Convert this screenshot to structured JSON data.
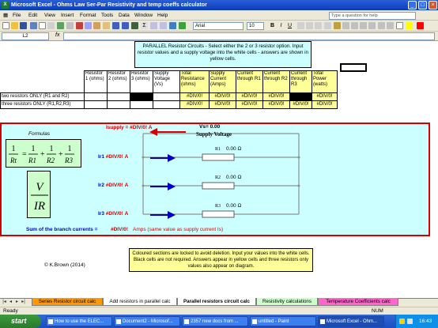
{
  "window": {
    "title": "Microsoft Excel - Ohms Law Ser-Par Resistivity and temp coeffs calculator",
    "app_icon_label": "X"
  },
  "menu": {
    "items": [
      "File",
      "Edit",
      "View",
      "Insert",
      "Format",
      "Tools",
      "Data",
      "Window",
      "Help"
    ],
    "help_placeholder": "Type a question for help"
  },
  "toolbar": {
    "font_name": "Arial",
    "font_size": "10",
    "bold": "B",
    "italic": "I",
    "underline": "U"
  },
  "formula_bar": {
    "name_box": "L2",
    "fx": "fx",
    "formula": ""
  },
  "sheet": {
    "top_note": "PARALLEL Resistor Circuits - Select either the 2 or 3 resistor option. Input resistor values and a supply voltage into the white cells - answers are shown in yellow cells.",
    "headers": [
      "Resistor 1 (ohms)",
      "Resistor 2 (ohms)",
      "Resistor 3 (ohms)",
      "Supply Voltage (Vs)",
      "Total Resistance (ohms)",
      "Supply Current (Amps)",
      "Current through R1",
      "Current through R2",
      "Current through R3",
      "Total Power (watts)"
    ],
    "rows": [
      {
        "label": "two resistors ONLY (R1 and R2)",
        "results": [
          "#DIV/0!",
          "#DIV/0!",
          "#DIV/0!",
          "#DIV/0!",
          "",
          "#DIV/0!"
        ]
      },
      {
        "label": "three resistors ONLY (R1,R2,R3)",
        "results": [
          "#DIV/0!",
          "#DIV/0!",
          "#DIV/0!",
          "#DIV/0!",
          "#DIV/0!",
          "#DIV/0!"
        ]
      }
    ]
  },
  "diagram": {
    "formulas_label": "Formulas",
    "formula1": {
      "lhs_num": "1",
      "lhs_den": "Rt",
      "terms": [
        {
          "num": "1",
          "den": "R1"
        },
        {
          "num": "1",
          "den": "R2"
        },
        {
          "num": "1",
          "den": "R3"
        }
      ]
    },
    "formula2": {
      "num": "V",
      "den": "IR"
    },
    "isupply_label": "Isupply =",
    "isupply_value": "#DIV/0!",
    "isupply_unit": "A",
    "vs_label": "Vs=",
    "vs_value": "0.00",
    "supply_voltage_label": "Supply Voltage",
    "branches": [
      {
        "label": "Ir1",
        "value": "#DIV/0!",
        "unit": "A",
        "resistor": "R1",
        "resistance": "0.00",
        "ohm": "Ω"
      },
      {
        "label": "Ir2",
        "value": "#DIV/0!",
        "unit": "A",
        "resistor": "R2",
        "resistance": "0.00",
        "ohm": "Ω"
      },
      {
        "label": "Ir3",
        "value": "#DIV/0!",
        "unit": "A",
        "resistor": "R3",
        "resistance": "0.00",
        "ohm": "Ω"
      }
    ],
    "sum_label": "Sum of the branch currents =",
    "sum_value": "#DIV/0!",
    "sum_note": "Amps (same value as supply current Is)",
    "colors": {
      "arrow_red": "#d60000",
      "arrow_blue": "#0000cc",
      "wire": "#909090"
    }
  },
  "bottom_note": "Coloured sections are locked to avoid deletion. Input your values into the white cells. Black cells are not required. Answers appear in yellow cells and three resistors only values also appear on diagram.",
  "copyright": "© K.Brown (2014)",
  "tabs": {
    "items": [
      {
        "label": "Series Resistor circuit calc",
        "color": "#ff9900"
      },
      {
        "label": "Add resistors in parallel calc",
        "color": "#ffffff"
      },
      {
        "label": "Parallel resistors circuit calc",
        "color": "#ffffff",
        "active": true
      },
      {
        "label": "Resistivity calculations",
        "color": "#ccffcc"
      },
      {
        "label": "Temperature Coefficients calc",
        "color": "#ff66cc"
      }
    ]
  },
  "status": {
    "ready": "Ready",
    "num": "NUM"
  },
  "taskbar": {
    "start": "start",
    "buttons": [
      "How to use the ELEC...",
      "Document2 - Microsof...",
      "2357 new docs from ...",
      "untitled - Paint",
      "Microsoft Excel - Ohm..."
    ],
    "clock": "16:43"
  }
}
